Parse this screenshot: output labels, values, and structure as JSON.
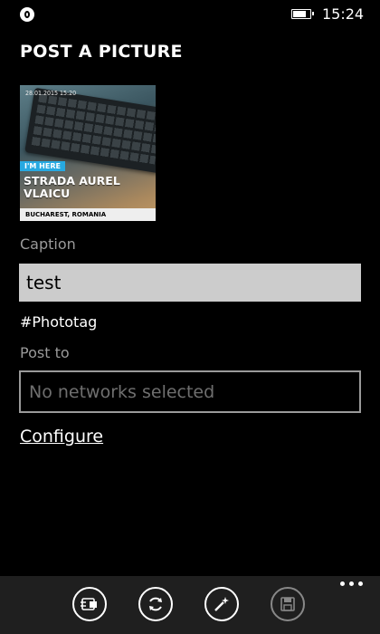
{
  "status_bar": {
    "time": "15:24",
    "battery_level": 0.85,
    "app_icon": "app-notification-icon"
  },
  "page": {
    "title": "POST A PICTURE"
  },
  "photo": {
    "date_stamp": "28.01.2015 15:20",
    "tag": "I'M HERE",
    "street": "STRADA AUREL VLAICU",
    "city": "BUCHAREST, ROMANIA"
  },
  "form": {
    "caption_label": "Caption",
    "caption_value": "test",
    "hashtag": "#Phototag",
    "post_to_label": "Post to",
    "networks_placeholder": "No networks selected",
    "configure_link": "Configure"
  },
  "app_bar": {
    "buttons": [
      {
        "icon": "card-edit-icon"
      },
      {
        "icon": "sync-icon"
      },
      {
        "icon": "magic-wand-icon"
      },
      {
        "icon": "save-icon",
        "enabled": false
      }
    ],
    "more_icon": "more-ellipsis-icon"
  }
}
